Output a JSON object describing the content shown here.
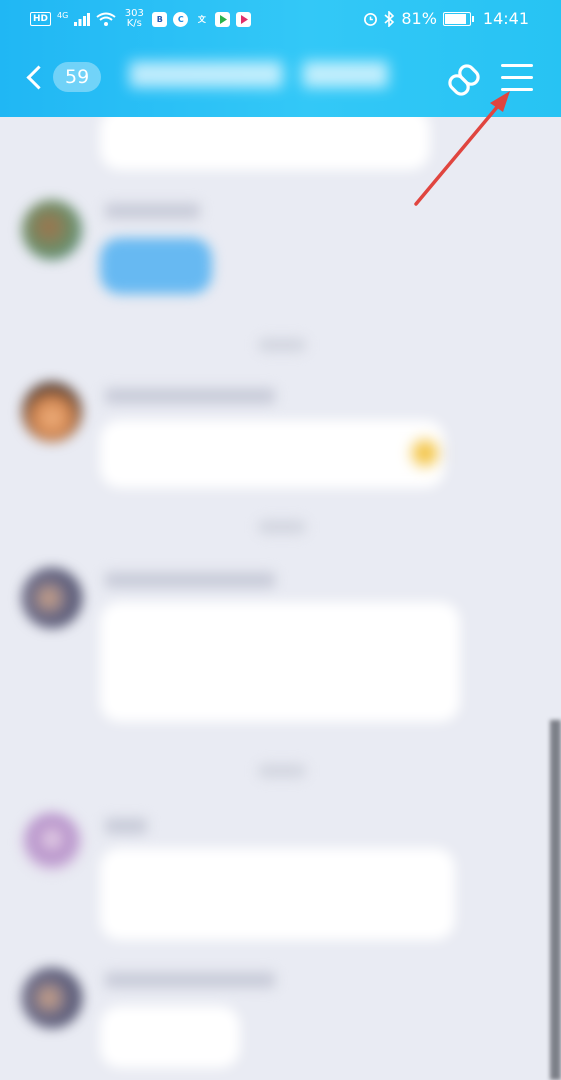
{
  "status_bar": {
    "left_indicators": [
      "HD",
      "4G",
      "303 K/s"
    ],
    "time": "14:41",
    "battery": "81%",
    "battery_level": 0.81,
    "icons": [
      "signal-icon",
      "wifi-icon",
      "alarm-icon",
      "bluetooth-icon",
      "battery-icon"
    ]
  },
  "header": {
    "unread_count": "59",
    "icons": [
      "back-chevron-icon",
      "link-icon",
      "menu-icon"
    ]
  },
  "messages": [
    {
      "type": "text",
      "side": "left",
      "blurred": true
    },
    {
      "type": "text",
      "side": "self",
      "blurred": true
    },
    {
      "type": "time",
      "blurred": true
    },
    {
      "type": "text",
      "side": "left",
      "blurred": true
    },
    {
      "type": "time",
      "blurred": true
    },
    {
      "type": "text",
      "side": "left",
      "blurred": true
    },
    {
      "type": "time",
      "blurred": true
    },
    {
      "type": "text",
      "side": "left",
      "blurred": true
    },
    {
      "type": "text",
      "side": "left",
      "blurred": true
    }
  ],
  "colors": {
    "header_start": "#20b7f4",
    "header_end": "#33c8f7",
    "background": "#e9ebf3",
    "bubble": "#ffffff",
    "self_bubble": "#67b9f2",
    "annotation_arrow": "#e0453f"
  }
}
